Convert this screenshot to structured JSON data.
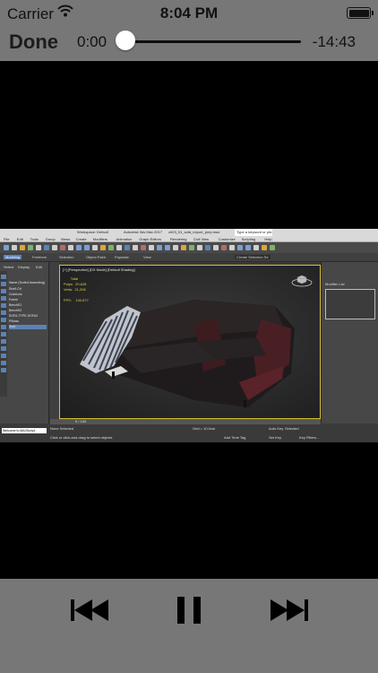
{
  "status_bar": {
    "carrier": "Carrier",
    "time": "8:04 PM",
    "battery_level": 1.0,
    "wifi_icon": "wifi-icon",
    "battery_icon": "battery-icon"
  },
  "player": {
    "done_label": "Done",
    "elapsed": "0:00",
    "remaining": "-14:43",
    "progress": 0.0
  },
  "video_frame": {
    "title_bar": {
      "workspace": "Workspace: Default",
      "app_title": "Autodesk 3ds Max 2017",
      "file_name": "ch03_01_sofa_export_prep.max",
      "search_placeholder": "Type a keyword or phrase"
    },
    "menu": [
      "File",
      "Edit",
      "Tools",
      "Group",
      "Views",
      "Create",
      "Modifiers",
      "Animation",
      "Graph Editors",
      "Rendering",
      "Civil View",
      "Customize",
      "Scripting",
      "Help"
    ],
    "toolbar2": {
      "left": "Modeling",
      "tabs": [
        "Freeform",
        "Selection",
        "Object Paint",
        "Populate"
      ],
      "sub": "Polygon Modeling",
      "view_dropdown": "View",
      "selection_set": "Create Selection Se"
    },
    "scene_explorer": {
      "tabs": [
        "Select",
        "Display",
        "Edit"
      ],
      "header": "Name (Sorted Ascending)",
      "rows": [
        "Shelf-CH",
        "Cushions",
        "Frame",
        "BenchS1",
        "BenchS2",
        "SOFA-TYPE-SOFA2",
        "Pillows",
        "Seat"
      ],
      "selected_index": 7
    },
    "viewport": {
      "label": "[+] [Perspective] [DX Mode] [Default Shading]",
      "stats": "       Total\nPolys:  20,628\nVerts:  21,206\n\nFPS:    130.677"
    },
    "command_panel": {
      "modifier_list": "Modifier List"
    },
    "timeline": {
      "frame": "0 / 100"
    },
    "status": {
      "maxscript": "Welcome to MAXScript.",
      "none_selected": "None Selected",
      "hint": "Click or click-and-drag to select objects",
      "grid": "Grid = 10.0cm",
      "add_time_tag": "Add Time Tag",
      "auto_key": "Auto Key",
      "selected": "Selected",
      "set_key": "Set Key",
      "key_filters": "Key Filters..."
    }
  },
  "transport": {
    "prev_icon": "skip-back-icon",
    "pause_icon": "pause-icon",
    "next_icon": "skip-forward-icon"
  }
}
